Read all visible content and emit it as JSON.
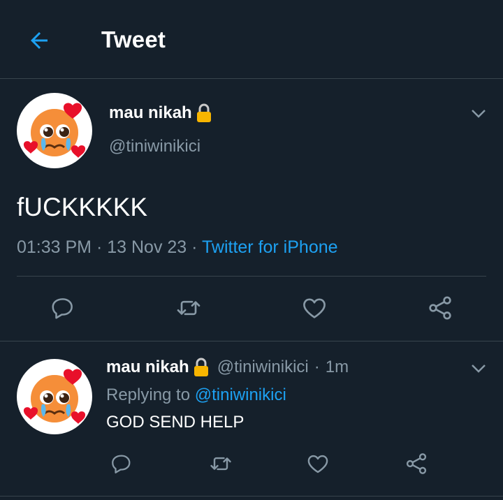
{
  "header": {
    "title": "Tweet"
  },
  "main_tweet": {
    "display_name": "mau nikah",
    "handle": "@tiniwinikici",
    "text": "fUCKKKKK",
    "time": "01:33 PM",
    "date": "13 Nov 23",
    "separator": "·",
    "source": "Twitter for iPhone"
  },
  "reply": {
    "display_name": "mau nikah",
    "handle": "@tiniwinikici",
    "separator": "·",
    "age": "1m",
    "replying_prefix": "Replying to",
    "replying_handle": "@tiniwinikici",
    "text": "GOD SEND HELP"
  },
  "colors": {
    "background": "#15202b",
    "accent": "#1da1f2",
    "muted": "#8899a6",
    "divider": "#38444d"
  },
  "icons": [
    "back-arrow-icon",
    "lock-icon",
    "chevron-down-icon",
    "reply-icon",
    "retweet-icon",
    "like-icon",
    "share-icon",
    "pleading-face-hearts-emoji"
  ]
}
